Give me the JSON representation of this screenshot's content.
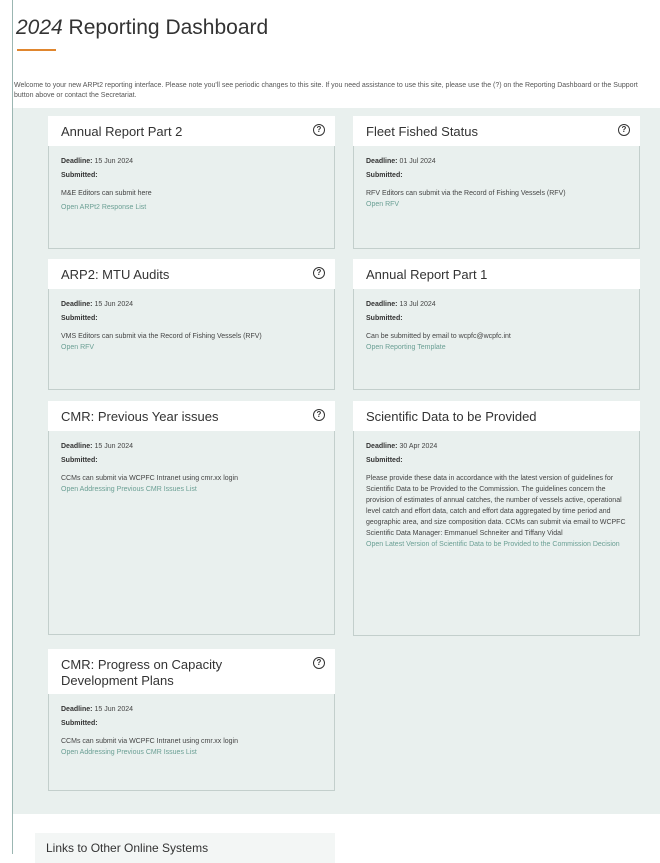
{
  "header": {
    "title_year": "2024",
    "title_rest": " Reporting Dashboard",
    "intro": "Welcome to your new ARPt2 reporting interface. Please note you'll see periodic changes to this site. If you need assistance to use this site, please use the (?) on the Reporting Dashboard or the Support button above or contact the Secretariat."
  },
  "cards": [
    {
      "title": "Annual Report Part 2",
      "deadline_label": "Deadline:",
      "deadline": "15 Jun 2024",
      "submitted_label": "Submitted:",
      "desc": "M&E Editors can submit here",
      "link": "Open ARPt2 Response List"
    },
    {
      "title": "Fleet Fished Status",
      "deadline_label": "Deadline:",
      "deadline": "01 Jul 2024",
      "submitted_label": "Submitted:",
      "desc": "RFV Editors can submit via the Record of Fishing Vessels (RFV)",
      "link": "Open RFV"
    },
    {
      "title": "ARP2: MTU Audits",
      "deadline_label": "Deadline:",
      "deadline": "15 Jun 2024",
      "submitted_label": "Submitted:",
      "desc": "VMS Editors can submit via the Record of Fishing Vessels (RFV)",
      "link": "Open RFV"
    },
    {
      "title": "Annual Report Part 1",
      "deadline_label": "Deadline:",
      "deadline": "13 Jul 2024",
      "submitted_label": "Submitted:",
      "desc": "Can be submitted by email to wcpfc@wcpfc.int",
      "link": "Open Reporting Template"
    },
    {
      "title": "CMR: Previous Year issues",
      "deadline_label": "Deadline:",
      "deadline": "15 Jun 2024",
      "submitted_label": "Submitted:",
      "desc": "CCMs can submit via WCPFC Intranet using cmr.xx login",
      "link": "Open Addressing Previous CMR Issues List"
    },
    {
      "title": "Scientific Data to be Provided",
      "deadline_label": "Deadline:",
      "deadline": "30 Apr 2024",
      "submitted_label": "Submitted:",
      "desc": "Please provide these data in accordance with the latest version of guidelines for Scientific Data to be Provided to the Commission. The guidelines concern the provision of estimates of annual catches, the number of vessels active, operational level catch and effort data, catch and effort data aggregated by time period and geographic area, and size composition data. CCMs can submit via email to WCPFC Scientific Data Manager: Emmanuel Schneiter and Tiffany Vidal",
      "link": "Open Latest Version of Scientific Data to be Provided to the Commission Decision"
    },
    {
      "title": "CMR: Progress on Capacity Development Plans",
      "deadline_label": "Deadline:",
      "deadline": "15 Jun 2024",
      "submitted_label": "Submitted:",
      "desc": "CCMs can submit via WCPFC Intranet using cmr.xx login",
      "link": "Open Addressing Previous CMR Issues List"
    }
  ],
  "help_glyph": "?",
  "links_section": {
    "title": "Links to Other Online Systems"
  },
  "icons": {
    "help": "help-circle-icon"
  },
  "colors": {
    "accent": "#e0862e",
    "link": "#6a9f94",
    "panel": "#e9f0ee"
  }
}
